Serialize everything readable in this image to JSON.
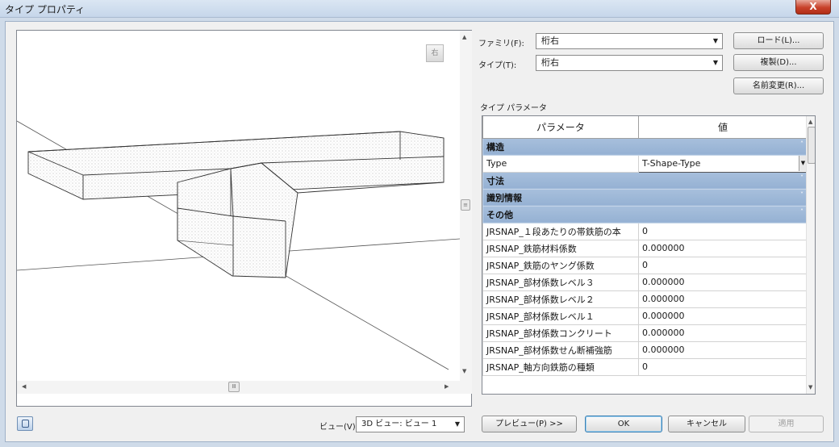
{
  "window": {
    "title": "タイプ プロパティ",
    "close": "X"
  },
  "preview": {
    "viewcube_label": "右",
    "view_label": "ビュー(V):",
    "view_value": "3D ビュー: ビュー 1"
  },
  "family": {
    "label": "ファミリ(F):",
    "value": "桁右"
  },
  "type": {
    "label": "タイプ(T):",
    "value": "桁右"
  },
  "buttons": {
    "load": "ロード(L)...",
    "duplicate": "複製(D)...",
    "rename": "名前変更(R)...",
    "preview": "プレビュー(P) >>",
    "ok": "OK",
    "cancel": "キャンセル",
    "apply": "適用"
  },
  "params": {
    "section_label": "タイプ パラメータ",
    "header_param": "パラメータ",
    "header_value": "値",
    "groups": {
      "structure": "構造",
      "dimensions": "寸法",
      "identity": "識別情報",
      "other": "その他"
    },
    "type_row": {
      "name": "Type",
      "value": "T-Shape-Type"
    },
    "other_rows": [
      {
        "name": "JRSNAP_１段あたりの帯鉄筋の本",
        "value": "0"
      },
      {
        "name": "JRSNAP_鉄筋材料係数",
        "value": "0.000000"
      },
      {
        "name": "JRSNAP_鉄筋のヤング係数",
        "value": "0"
      },
      {
        "name": "JRSNAP_部材係数レベル３",
        "value": "0.000000"
      },
      {
        "name": "JRSNAP_部材係数レベル２",
        "value": "0.000000"
      },
      {
        "name": "JRSNAP_部材係数レベル１",
        "value": "0.000000"
      },
      {
        "name": "JRSNAP_部材係数コンクリート",
        "value": "0.000000"
      },
      {
        "name": "JRSNAP_部材係数せん断補強筋",
        "value": "0.000000"
      },
      {
        "name": "JRSNAP_軸方向鉄筋の種類",
        "value": "0"
      }
    ]
  }
}
